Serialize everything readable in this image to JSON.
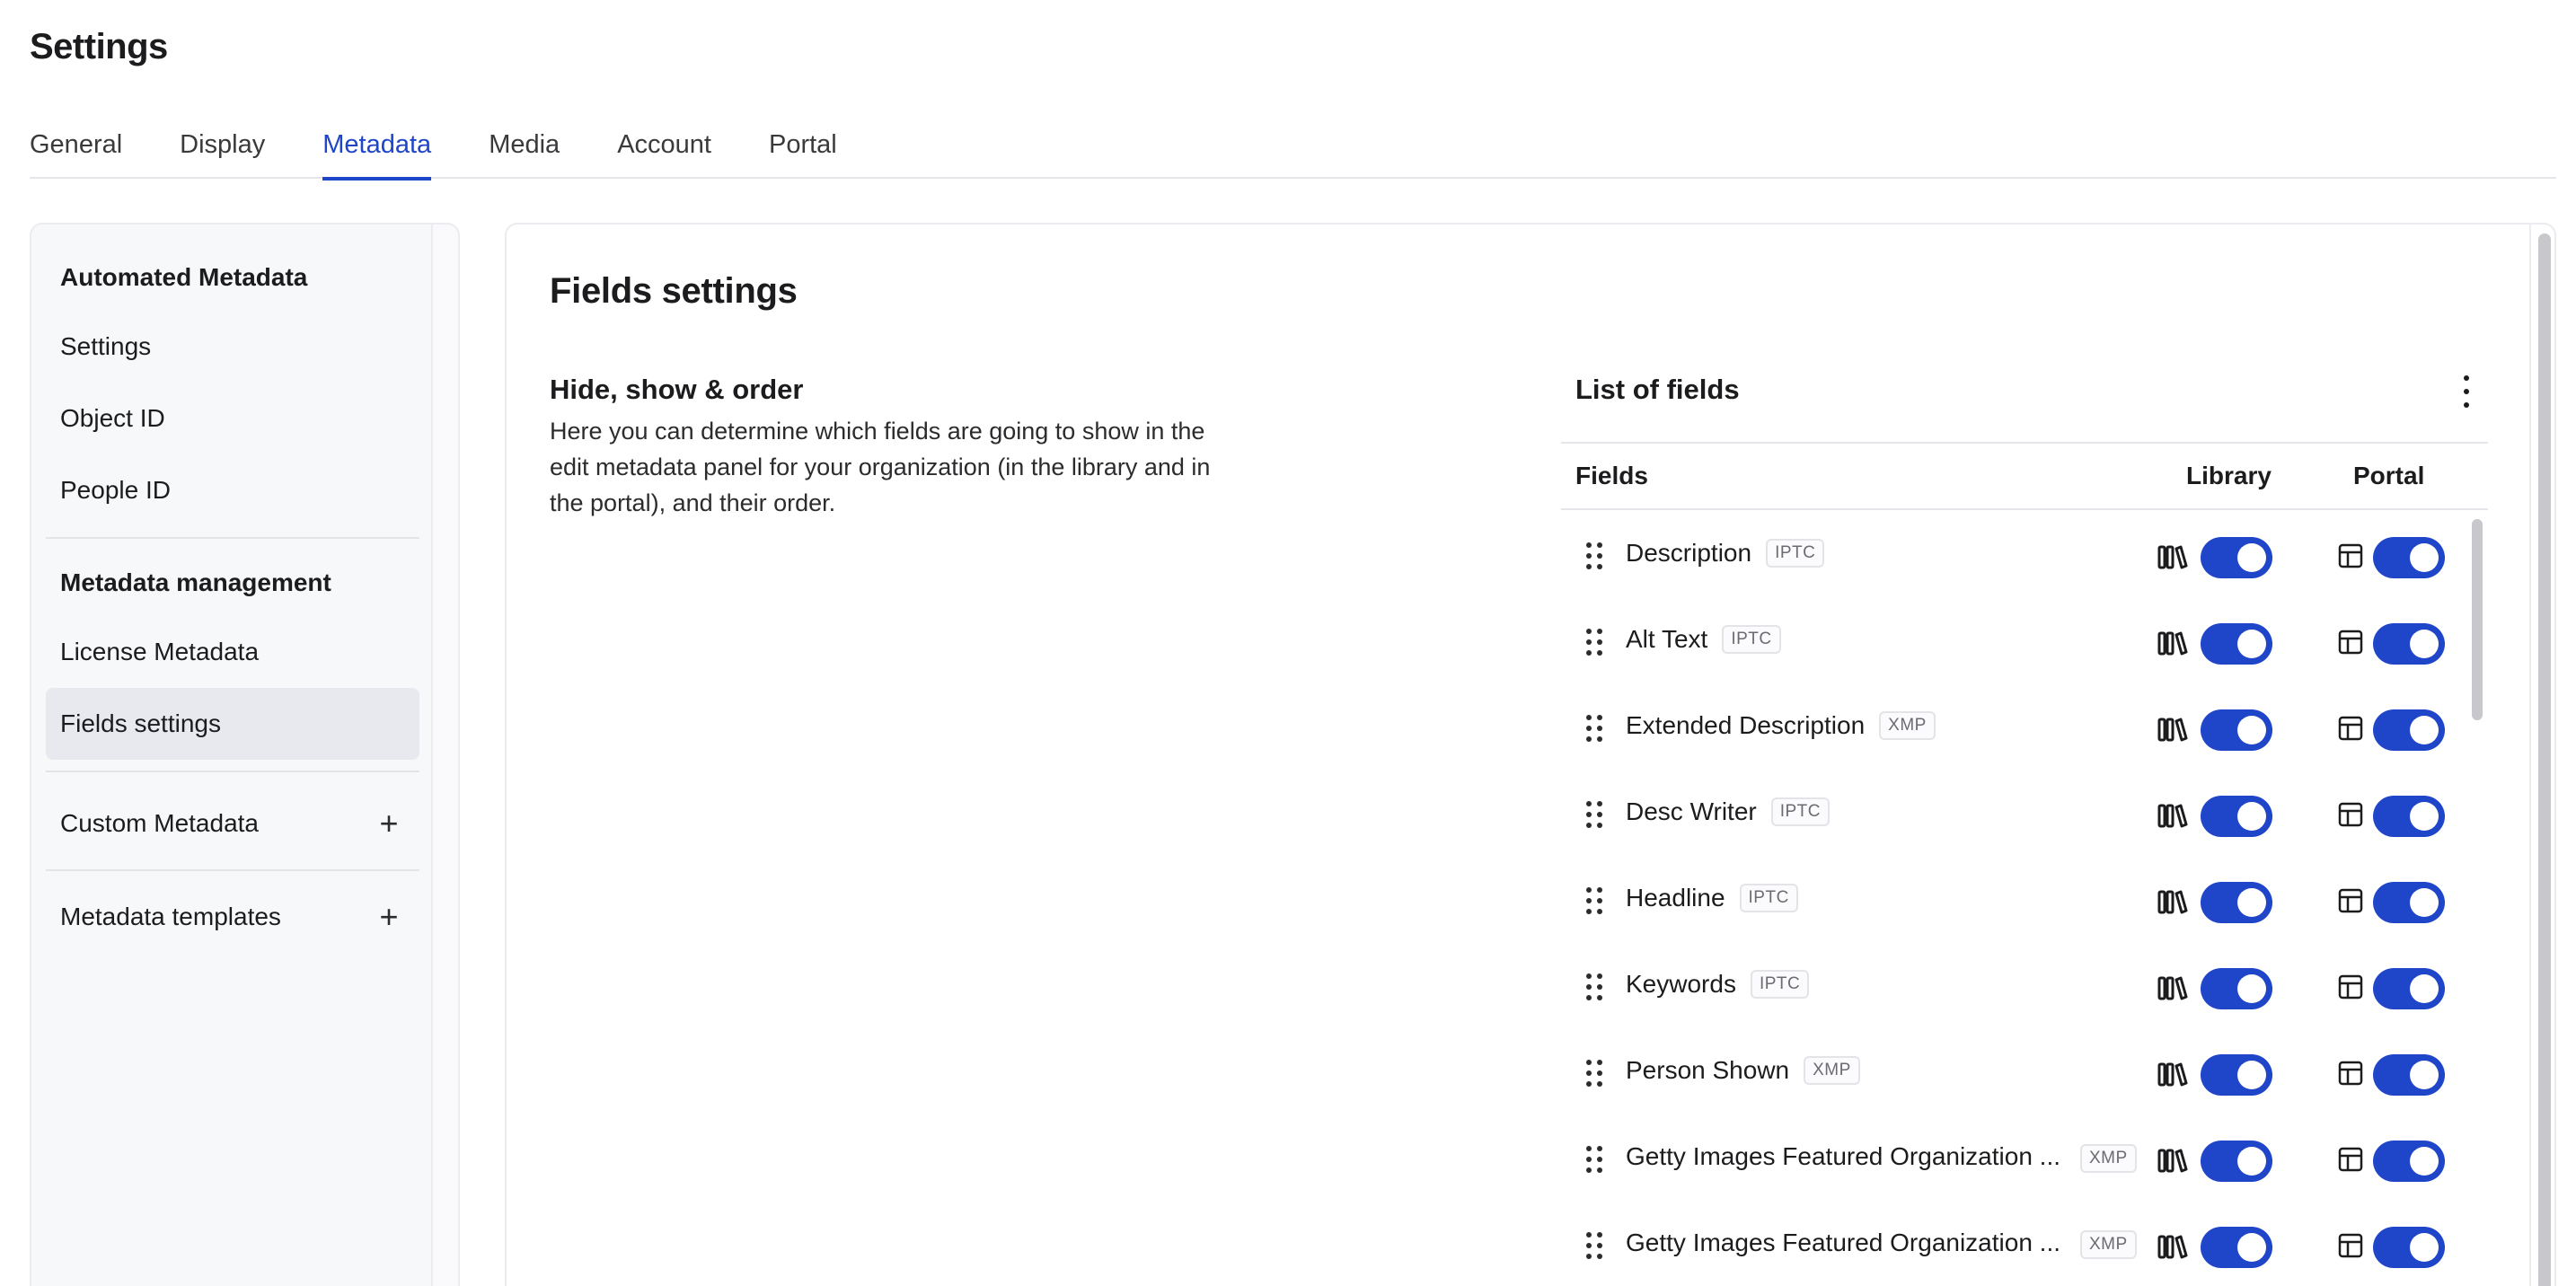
{
  "page": {
    "title": "Settings"
  },
  "tabs": [
    {
      "label": "General"
    },
    {
      "label": "Display"
    },
    {
      "label": "Metadata",
      "active": true
    },
    {
      "label": "Media"
    },
    {
      "label": "Account"
    },
    {
      "label": "Portal"
    }
  ],
  "sidebar": {
    "section1": {
      "heading": "Automated Metadata",
      "items": [
        "Settings",
        "Object ID",
        "People ID"
      ]
    },
    "section2": {
      "heading": "Metadata management",
      "items": [
        "License Metadata",
        "Fields settings"
      ],
      "active_item": "Fields settings"
    },
    "custom_metadata": "Custom Metadata",
    "metadata_templates": "Metadata templates"
  },
  "main": {
    "title": "Fields settings",
    "section_title": "Hide, show & order",
    "section_desc": "Here you can determine which fields are going to show in the edit metadata panel for your organization (in the library and in the portal), and their order.",
    "list": {
      "title": "List of fields",
      "col_fields": "Fields",
      "col_library": "Library",
      "col_portal": "Portal",
      "rows": [
        {
          "name": "Description",
          "badge": "IPTC",
          "library": true,
          "portal": true
        },
        {
          "name": "Alt Text",
          "badge": "IPTC",
          "library": true,
          "portal": true
        },
        {
          "name": "Extended Description",
          "badge": "XMP",
          "library": true,
          "portal": true
        },
        {
          "name": "Desc Writer",
          "badge": "IPTC",
          "library": true,
          "portal": true
        },
        {
          "name": "Headline",
          "badge": "IPTC",
          "library": true,
          "portal": true
        },
        {
          "name": "Keywords",
          "badge": "IPTC",
          "library": true,
          "portal": true
        },
        {
          "name": "Person Shown",
          "badge": "XMP",
          "library": true,
          "portal": true
        },
        {
          "name": "Getty Images Featured Organization ...",
          "badge": "XMP",
          "library": true,
          "portal": true
        },
        {
          "name": "Getty Images Featured Organization ...",
          "badge": "XMP",
          "library": true,
          "portal": true
        }
      ]
    }
  },
  "colors": {
    "accent": "#1f45c9",
    "sidebar_bg": "#f7f8fa",
    "active_item_bg": "#e8e9ee"
  }
}
